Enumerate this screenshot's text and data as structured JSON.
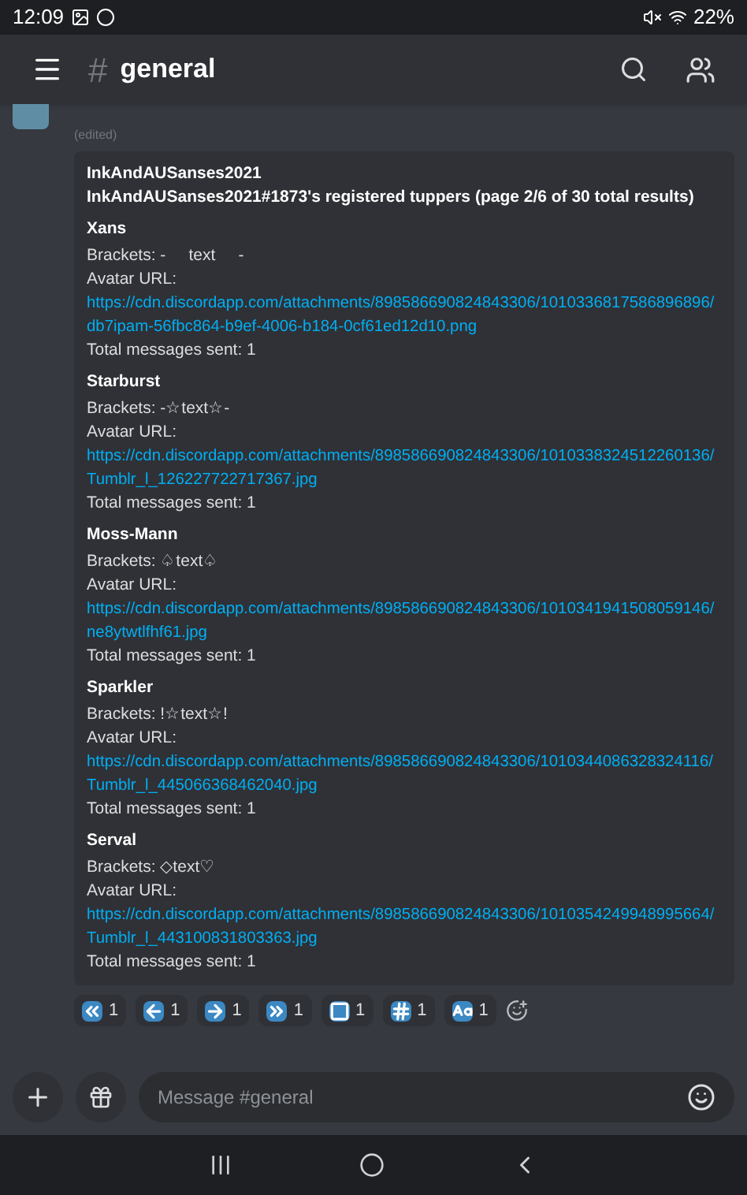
{
  "status_bar": {
    "time": "12:09",
    "battery": "22%"
  },
  "header": {
    "channel_glyph": "#",
    "channel": "general"
  },
  "message": {
    "edited": "(edited)",
    "embed": {
      "author": "InkAndAUSanses2021",
      "title": "InkAndAUSanses2021#1873's registered tuppers (page 2/6 of 30 total results)",
      "fields": [
        {
          "name": "Xans",
          "brackets": "Brackets: -     text     -",
          "avatar_label": "Avatar URL:",
          "url": "https://cdn.discordapp.com/attachments/898586690824843306/1010336817586896896/db7ipam-56fbc864-b9ef-4006-b184-0cf61ed12d10.png",
          "total": "Total messages sent: 1"
        },
        {
          "name": "Starburst",
          "brackets": "Brackets: -☆text☆-",
          "avatar_label": "Avatar URL:",
          "url": "https://cdn.discordapp.com/attachments/898586690824843306/1010338324512260136/Tumblr_l_126227722717367.jpg",
          "total": "Total messages sent: 1"
        },
        {
          "name": "Moss-Mann",
          "brackets": "Brackets: ♤text♤",
          "avatar_label": "Avatar URL:",
          "url": "https://cdn.discordapp.com/attachments/898586690824843306/1010341941508059146/ne8ytwtlfhf61.jpg",
          "total": "Total messages sent: 1"
        },
        {
          "name": "Sparkler",
          "brackets": "Brackets: !☆text☆!",
          "avatar_label": "Avatar URL:",
          "url": "https://cdn.discordapp.com/attachments/898586690824843306/1010344086328324116/Tumblr_l_445066368462040.jpg",
          "total": "Total messages sent: 1"
        },
        {
          "name": "Serval",
          "brackets": "Brackets: ◇text♡",
          "avatar_label": "Avatar URL:",
          "url": "https://cdn.discordapp.com/attachments/898586690824843306/1010354249948995664/Tumblr_l_443100831803363.jpg",
          "total": "Total messages sent: 1"
        }
      ]
    },
    "reactions": [
      {
        "kind": "first",
        "count": "1"
      },
      {
        "kind": "previous",
        "count": "1"
      },
      {
        "kind": "next",
        "count": "1"
      },
      {
        "kind": "last",
        "count": "1"
      },
      {
        "kind": "stop",
        "count": "1"
      },
      {
        "kind": "page",
        "count": "1"
      },
      {
        "kind": "search",
        "count": "1"
      }
    ]
  },
  "composer": {
    "placeholder": "Message #general"
  }
}
